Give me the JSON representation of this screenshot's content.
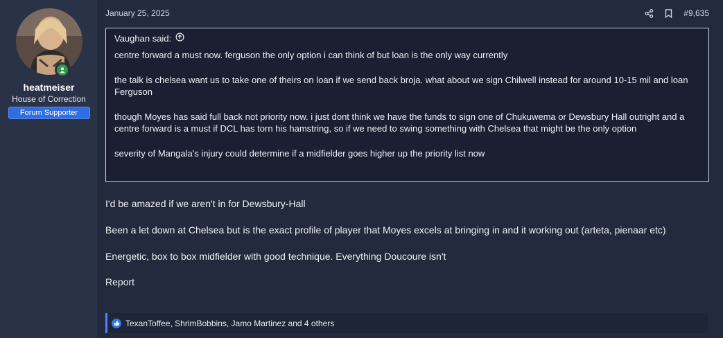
{
  "user": {
    "name": "heatmeiser",
    "title": "House of Correction",
    "banner": "Forum Supporter"
  },
  "post": {
    "date": "January 25, 2025",
    "number": "#9,635",
    "quote": {
      "author_label": "Vaughan said:",
      "paragraphs": [
        "centre forward a must now. ferguson the only option i can think of but loan is the only way currently",
        "the talk is chelsea want us to take one of theirs on loan if we send back broja. what about we sign Chilwell instead for around 10-15 mil and loan Ferguson",
        "though Moyes has said full back not priority now. i just dont think we have the funds to sign one of Chukuwema or Dewsbury Hall outright and a centre forward is a must if DCL has torn his hamstring, so if we need to swing something with Chelsea that might be the only option",
        "severity of Mangala's injury could determine if a midfielder goes higher up the priority list now"
      ]
    },
    "message": [
      "I'd be amazed if we aren't in for Dewsbury-Hall",
      "Been a let down at Chelsea but is the exact profile of player that Moyes excels at bringing in and it working out (arteta, pienaar etc)",
      "Energetic, box to box midfielder with good technique. Everything Doucoure isn't"
    ],
    "report_label": "Report",
    "reactions_text": "TexanToffee, ShrimBobbins, Jamo Martinez and 4 others"
  },
  "icons": {
    "share": "share-icon",
    "bookmark": "bookmark-icon",
    "quote_up": "arrow-up-circle-icon",
    "like": "thumbs-up-icon",
    "online": "online-status-icon"
  },
  "colors": {
    "background": "#232a3d",
    "user_column": "#2a3247",
    "banner": "#2f6de0",
    "online": "#2f9a43",
    "reaction_accent": "#5b7cff"
  }
}
